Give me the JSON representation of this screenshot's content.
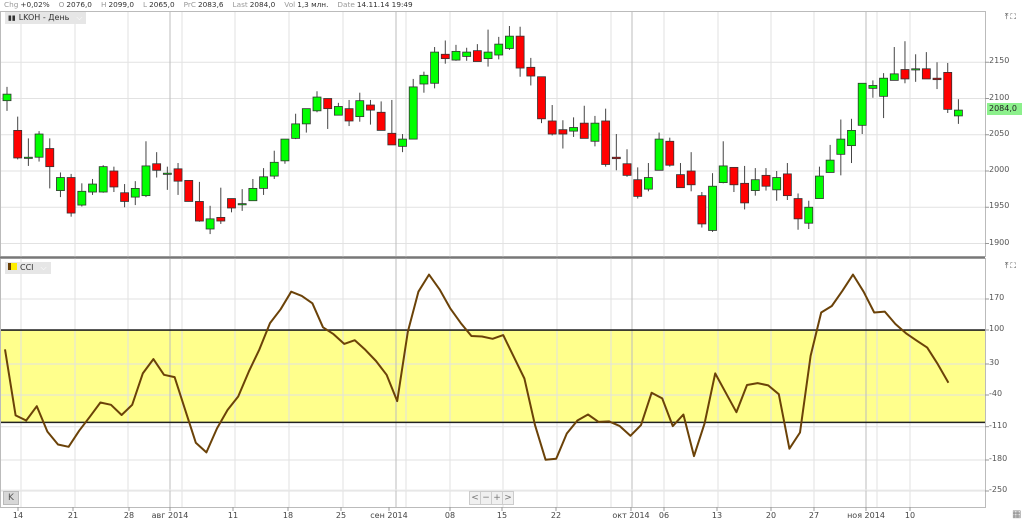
{
  "infobar": [
    {
      "key": "Chg",
      "value": "+0,02%"
    },
    {
      "key": "O",
      "value": "2076,0"
    },
    {
      "key": "H",
      "value": "2099,0"
    },
    {
      "key": "L",
      "value": "2065,0"
    },
    {
      "key": "PrC",
      "value": "2083,6"
    },
    {
      "key": "Last",
      "value": "2084,0"
    },
    {
      "key": "Vol",
      "value": "1,3 млн."
    },
    {
      "key": "Date",
      "value": "14.11.14 19:49"
    }
  ],
  "price_pane": {
    "legend": "LKOH - День",
    "last_price": "2084,0",
    "axis_labels": [
      "2150",
      "2100",
      "2050",
      "2000",
      "1950",
      "1900"
    ]
  },
  "cci_pane": {
    "legend": "CCI",
    "axis_labels": [
      "170",
      "100",
      "30",
      "-40",
      "-110",
      "-180",
      "-250"
    ]
  },
  "colors": {
    "up": "#00ff00",
    "down": "#ff0000",
    "cci_line": "#6b4208",
    "band": "#ffff8c",
    "last_price_bg": "#8cf08c"
  },
  "navigation": {
    "reset": "K",
    "prev": "<",
    "zoom_out": "−",
    "zoom_in": "+",
    "next": ">"
  },
  "x_labels": [
    "14",
    "21",
    "28",
    "авг 2014",
    "11",
    "18",
    "25",
    "сен 2014",
    "08",
    "15",
    "22",
    "окт 2014",
    "06",
    "13",
    "20",
    "27",
    "ноя 2014",
    "10"
  ],
  "chart_data": [
    {
      "type": "candlestick",
      "title": "LKOH - День",
      "ylim": [
        1880,
        2200
      ],
      "yticks": [
        1900,
        1950,
        2000,
        2050,
        2100,
        2150
      ],
      "ohlc": [
        [
          2097,
          2116,
          2083,
          2106
        ],
        [
          2056,
          2075,
          2016,
          2018
        ],
        [
          2019,
          2045,
          2007,
          2019
        ],
        [
          2019,
          2055,
          2013,
          2051
        ],
        [
          2031,
          2045,
          1976,
          2006
        ],
        [
          1973,
          1998,
          1964,
          1991
        ],
        [
          1991,
          1996,
          1937,
          1942
        ],
        [
          1953,
          1983,
          1951,
          1972
        ],
        [
          1971,
          1989,
          1967,
          1982
        ],
        [
          1971,
          2008,
          1970,
          2006
        ],
        [
          2000,
          2006,
          1971,
          1978
        ],
        [
          1970,
          1982,
          1950,
          1958
        ],
        [
          1964,
          1986,
          1953,
          1976
        ],
        [
          1966,
          2041,
          1964,
          2007
        ],
        [
          2010,
          2026,
          1991,
          2001
        ],
        [
          1997,
          2006,
          1974,
          1997
        ],
        [
          2003,
          2011,
          1967,
          1986
        ],
        [
          1987,
          1987,
          1958,
          1958
        ],
        [
          1958,
          1985,
          1930,
          1931
        ],
        [
          1920,
          1952,
          1913,
          1934
        ],
        [
          1936,
          1977,
          1927,
          1931
        ],
        [
          1962,
          1962,
          1943,
          1949
        ],
        [
          1955,
          1975,
          1945,
          1955
        ],
        [
          1959,
          1989,
          1959,
          1976
        ],
        [
          1976,
          2004,
          1967,
          1992
        ],
        [
          1993,
          2028,
          1989,
          2012
        ],
        [
          2014,
          2044,
          2010,
          2044
        ],
        [
          2045,
          2079,
          2044,
          2065
        ],
        [
          2065,
          2086,
          2053,
          2086
        ],
        [
          2083,
          2110,
          2081,
          2102
        ],
        [
          2100,
          2100,
          2058,
          2086
        ],
        [
          2077,
          2094,
          2077,
          2089
        ],
        [
          2086,
          2098,
          2062,
          2069
        ],
        [
          2075,
          2108,
          2068,
          2097
        ],
        [
          2091,
          2098,
          2064,
          2084
        ],
        [
          2081,
          2096,
          2056,
          2056
        ],
        [
          2052,
          2098,
          2036,
          2036
        ],
        [
          2034,
          2051,
          2026,
          2044
        ],
        [
          2044,
          2127,
          2044,
          2116
        ],
        [
          2120,
          2137,
          2108,
          2132
        ],
        [
          2121,
          2171,
          2114,
          2164
        ],
        [
          2161,
          2180,
          2148,
          2155
        ],
        [
          2153,
          2174,
          2152,
          2165
        ],
        [
          2158,
          2170,
          2152,
          2164
        ],
        [
          2166,
          2175,
          2151,
          2151
        ],
        [
          2155,
          2195,
          2144,
          2164
        ],
        [
          2160,
          2185,
          2154,
          2175
        ],
        [
          2169,
          2200,
          2167,
          2186
        ],
        [
          2186,
          2199,
          2130,
          2142
        ],
        [
          2143,
          2156,
          2118,
          2131
        ],
        [
          2130,
          2130,
          2066,
          2072
        ],
        [
          2069,
          2091,
          2049,
          2051
        ],
        [
          2057,
          2070,
          2031,
          2051
        ],
        [
          2055,
          2074,
          2047,
          2060
        ],
        [
          2066,
          2090,
          2045,
          2045
        ],
        [
          2041,
          2076,
          2034,
          2066
        ],
        [
          2069,
          2086,
          2006,
          2009
        ],
        [
          2019,
          2051,
          2001,
          2017
        ],
        [
          2010,
          2030,
          1992,
          1994
        ],
        [
          1988,
          2005,
          1962,
          1965
        ],
        [
          1975,
          2011,
          1972,
          1991
        ],
        [
          2001,
          2053,
          2001,
          2044
        ],
        [
          2041,
          2046,
          2006,
          2008
        ],
        [
          1995,
          2011,
          1977,
          1977
        ],
        [
          2000,
          2026,
          1972,
          1981
        ],
        [
          1966,
          1971,
          1922,
          1927
        ],
        [
          1918,
          1997,
          1916,
          1979
        ],
        [
          1984,
          2041,
          1983,
          2007
        ],
        [
          2005,
          2005,
          1971,
          1981
        ],
        [
          1983,
          2007,
          1947,
          1956
        ],
        [
          1973,
          2004,
          1966,
          1988
        ],
        [
          1994,
          2004,
          1973,
          1979
        ],
        [
          1974,
          2000,
          1959,
          1991
        ],
        [
          1996,
          2011,
          1960,
          1966
        ],
        [
          1962,
          1969,
          1919,
          1934
        ],
        [
          1928,
          1959,
          1920,
          1950
        ],
        [
          1962,
          2006,
          1962,
          1993
        ],
        [
          1998,
          2036,
          1998,
          2015
        ],
        [
          2023,
          2071,
          1994,
          2044
        ],
        [
          2035,
          2072,
          2011,
          2056
        ],
        [
          2063,
          2121,
          2051,
          2121
        ],
        [
          2114,
          2125,
          2101,
          2118
        ],
        [
          2103,
          2135,
          2073,
          2128
        ],
        [
          2125,
          2171,
          2125,
          2134
        ],
        [
          2140,
          2179,
          2121,
          2127
        ],
        [
          2141,
          2161,
          2123,
          2141
        ],
        [
          2141,
          2164,
          2127,
          2127
        ],
        [
          2128,
          2150,
          2113,
          2126
        ],
        [
          2136,
          2149,
          2080,
          2085
        ],
        [
          2076,
          2099,
          2065,
          2084
        ]
      ]
    },
    {
      "type": "line",
      "title": "CCI",
      "ylim": [
        -270,
        230
      ],
      "yticks": [
        170,
        100,
        30,
        -40,
        -110,
        -180,
        -250
      ],
      "band": [
        -100,
        100
      ],
      "values": [
        58,
        -85,
        -96,
        -65,
        -120,
        -148,
        -153,
        -118,
        -88,
        -57,
        -62,
        -84,
        -62,
        6,
        37,
        3,
        -2,
        -73,
        -144,
        -165,
        -113,
        -73,
        -44,
        10,
        58,
        115,
        145,
        183,
        174,
        158,
        106,
        91,
        70,
        78,
        57,
        33,
        3,
        -54,
        96,
        183,
        220,
        188,
        147,
        115,
        87,
        86,
        81,
        89,
        42,
        -5,
        -106,
        -181,
        -179,
        -124,
        -96,
        -83,
        -99,
        -98,
        -108,
        -129,
        -106,
        -36,
        -48,
        -108,
        -83,
        -173,
        -102,
        6,
        -36,
        -78,
        -19,
        -15,
        -20,
        -39,
        -157,
        -122,
        44,
        138,
        152,
        185,
        220,
        183,
        138,
        140,
        113,
        93,
        77,
        62,
        26,
        -14
      ]
    }
  ]
}
